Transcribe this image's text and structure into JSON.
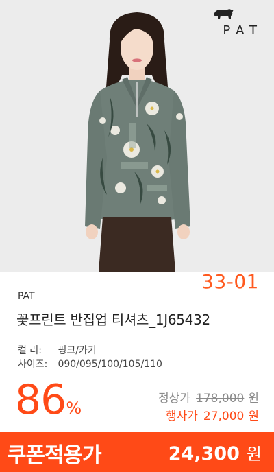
{
  "brand_logo": {
    "text": "PAT",
    "icon": "rhino-icon"
  },
  "product": {
    "code": "33-01",
    "brand": "PAT",
    "title": "꽃프린트 반집업 티셔츠_1J65432"
  },
  "specs": {
    "color_label": "컬    러:",
    "color_value": "핑크/카키",
    "size_label": "사이즈:",
    "size_value": "090/095/100/105/110"
  },
  "pricing": {
    "discount_rate": "86",
    "discount_unit": "%",
    "regular_label": "정상가",
    "regular_price": "178,000",
    "event_label": "행사가",
    "event_price": "27,000",
    "currency": "원"
  },
  "coupon": {
    "label": "쿠폰적용가",
    "price": "24,300",
    "currency": "원"
  },
  "colors": {
    "accent": "#ff4a17",
    "shirt": "#6f7f78",
    "pants": "#3b2a22"
  }
}
